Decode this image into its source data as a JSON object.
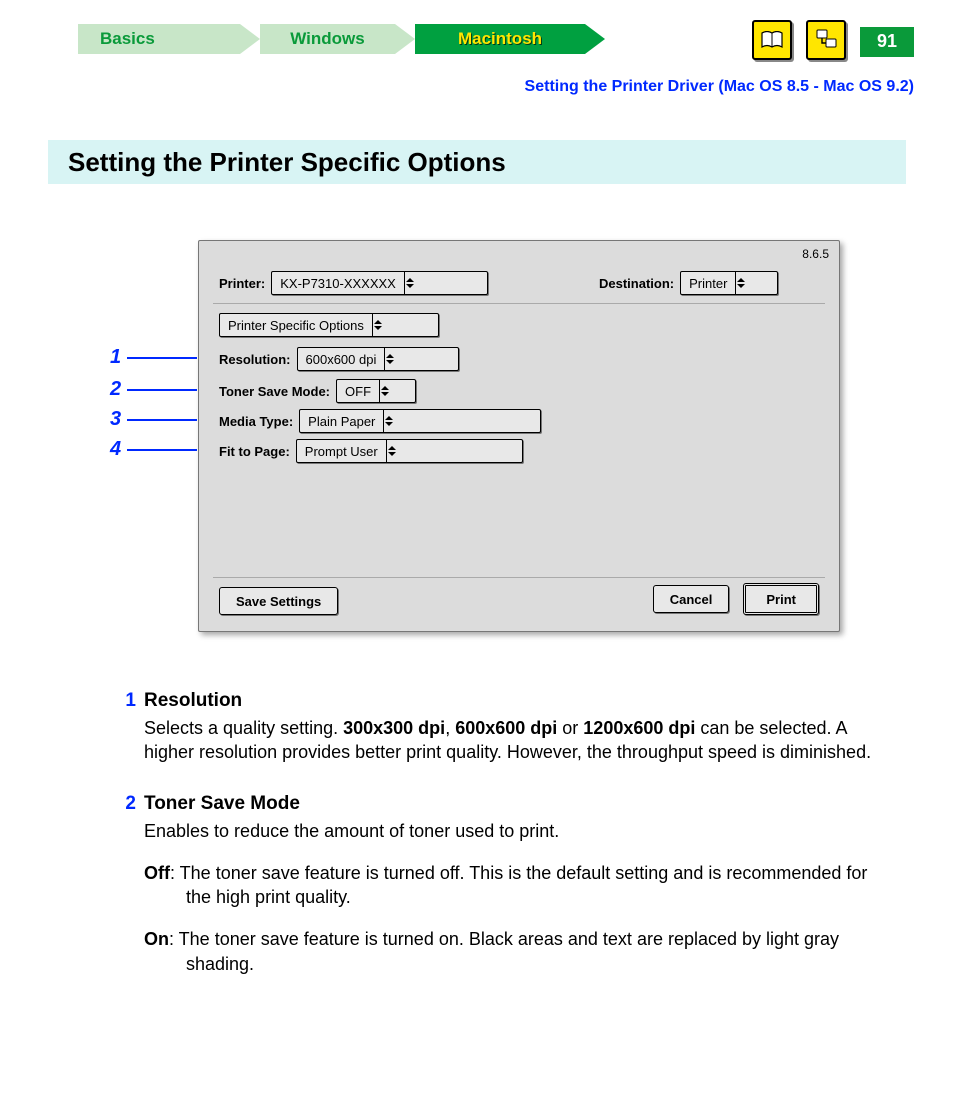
{
  "tabs": {
    "basics": "Basics",
    "windows": "Windows",
    "macintosh": "Macintosh"
  },
  "page_number": "91",
  "subheader": "Setting the Printer Driver (Mac OS 8.5 - Mac OS 9.2)",
  "title": "Setting the Printer Specific Options",
  "dialog": {
    "version": "8.6.5",
    "printer_label": "Printer:",
    "printer_value": "KX-P7310-XXXXXX",
    "destination_label": "Destination:",
    "destination_value": "Printer",
    "panel_select": "Printer Specific Options",
    "rows": {
      "resolution_label": "Resolution:",
      "resolution_value": "600x600 dpi",
      "toner_label": "Toner Save Mode:",
      "toner_value": "OFF",
      "media_label": "Media Type:",
      "media_value": "Plain Paper",
      "fit_label": "Fit to Page:",
      "fit_value": "Prompt User"
    },
    "buttons": {
      "save": "Save Settings",
      "cancel": "Cancel",
      "print": "Print"
    }
  },
  "callout_numbers": {
    "n1": "1",
    "n2": "2",
    "n3": "3",
    "n4": "4"
  },
  "descriptions": [
    {
      "num": "1",
      "title": "Resolution",
      "body": "Selects a quality setting. <b>300x300 dpi</b>, <b>600x600 dpi</b> or <b>1200x600 dpi</b> can be selected. A higher resolution provides better print quality. However, the throughput speed is diminished."
    },
    {
      "num": "2",
      "title": "Toner Save Mode",
      "body_intro": "Enables to reduce the amount of toner used to print.",
      "off": "<b>Off</b>: The toner save feature is turned off. This is the default setting and is recommended for the high print quality.",
      "on": "<b>On</b>: The toner save feature is turned on. Black areas and text are replaced by light gray shading."
    }
  ]
}
